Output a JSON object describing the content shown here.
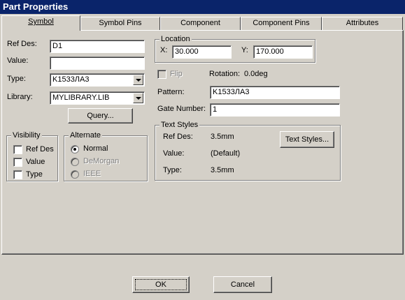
{
  "window": {
    "title": "Part Properties"
  },
  "tabs": [
    {
      "label": "Symbol",
      "active": true
    },
    {
      "label": "Symbol Pins",
      "active": false
    },
    {
      "label": "Component",
      "active": false
    },
    {
      "label": "Component Pins",
      "active": false
    },
    {
      "label": "Attributes",
      "active": false
    }
  ],
  "symbol": {
    "refdes_label": "Ref Des:",
    "refdes_value": "D1",
    "value_label": "Value:",
    "value_value": "",
    "type_label": "Type:",
    "type_value": "K1533ЛA3",
    "library_label": "Library:",
    "library_value": "MYLIBRARY.LIB",
    "query_button": "Query..."
  },
  "visibility": {
    "title": "Visibility",
    "items": [
      {
        "label": "Ref Des",
        "checked": false
      },
      {
        "label": "Value",
        "checked": false
      },
      {
        "label": "Type",
        "checked": false
      }
    ]
  },
  "alternate": {
    "title": "Alternate",
    "items": [
      {
        "label": "Normal",
        "selected": true,
        "enabled": true
      },
      {
        "label": "DeMorgan",
        "selected": false,
        "enabled": false
      },
      {
        "label": "IEEE",
        "selected": false,
        "enabled": false
      }
    ]
  },
  "location": {
    "title": "Location",
    "x_label": "X:",
    "x_value": "30.000",
    "y_label": "Y:",
    "y_value": "170.000"
  },
  "flip": {
    "label": "Flip",
    "checked": false,
    "enabled": false
  },
  "rotation": {
    "label": "Rotation:",
    "value": "0.0deg"
  },
  "pattern": {
    "label": "Pattern:",
    "value": "K1533ЛA3"
  },
  "gate": {
    "label": "Gate Number:",
    "value": "1"
  },
  "text_styles": {
    "title": "Text Styles",
    "rows": [
      {
        "label": "Ref Des:",
        "value": "3.5mm"
      },
      {
        "label": "Value:",
        "value": "(Default)"
      },
      {
        "label": "Type:",
        "value": "3.5mm"
      }
    ],
    "button": "Text Styles..."
  },
  "footer": {
    "ok": "OK",
    "cancel": "Cancel"
  }
}
